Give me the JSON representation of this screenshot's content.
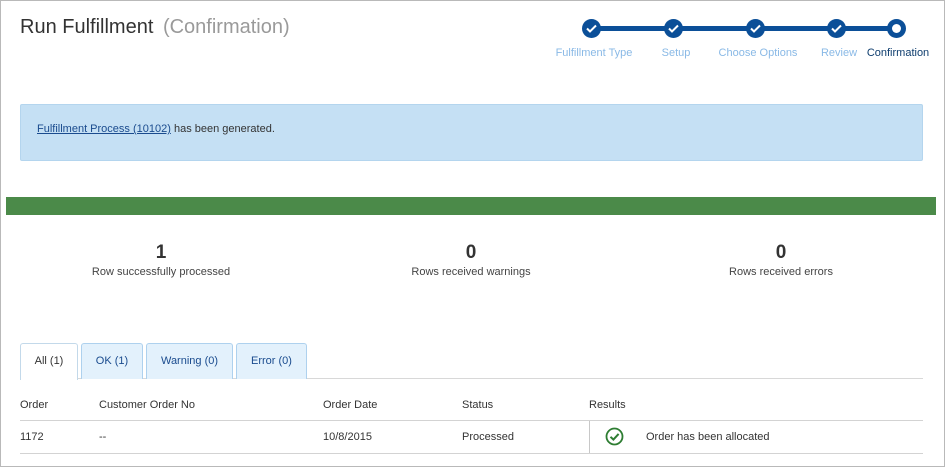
{
  "header": {
    "title": "Run Fulfillment",
    "subtitle": "(Confirmation)"
  },
  "wizard": {
    "steps": [
      {
        "label": "Fulfillment Type",
        "state": "complete"
      },
      {
        "label": "Setup",
        "state": "complete"
      },
      {
        "label": "Choose Options",
        "state": "complete"
      },
      {
        "label": "Review",
        "state": "complete"
      },
      {
        "label": "Confirmation",
        "state": "current"
      }
    ],
    "colors": {
      "active": "#0b4f98",
      "complete_label": "#89b9e6",
      "current_label": "#0e3d6e"
    }
  },
  "alert": {
    "link_text": "Fulfillment Process (10102)",
    "message": "has been generated."
  },
  "progress": {
    "fraction_success": 1.0,
    "color": "#4b8a49"
  },
  "summary": [
    {
      "count": "1",
      "label": "Row successfully processed"
    },
    {
      "count": "0",
      "label": "Rows received warnings"
    },
    {
      "count": "0",
      "label": "Rows received errors"
    }
  ],
  "tabs": [
    {
      "label": "All (1)",
      "active": true
    },
    {
      "label": "OK (1)",
      "active": false
    },
    {
      "label": "Warning (0)",
      "active": false
    },
    {
      "label": "Error (0)",
      "active": false
    }
  ],
  "table": {
    "columns": [
      "Order",
      "Customer Order No",
      "Order Date",
      "Status",
      "Results"
    ],
    "rows": [
      {
        "order": "1172",
        "customer_order_no": "--",
        "order_date": "10/8/2015",
        "status": "Processed",
        "result_icon": "check-circle-icon",
        "result": "Order has been allocated"
      }
    ]
  }
}
